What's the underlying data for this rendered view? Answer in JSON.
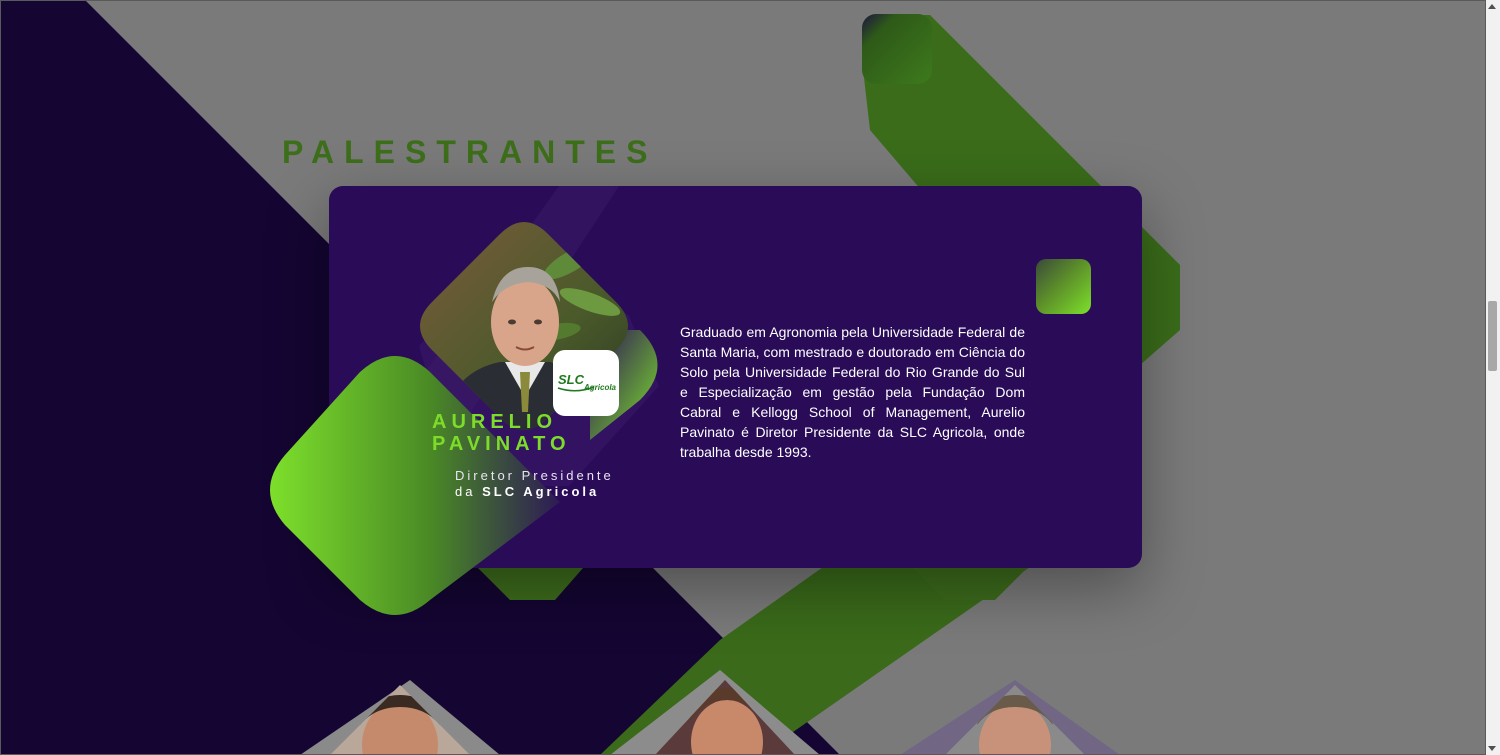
{
  "section": {
    "title": "PALESTRANTES"
  },
  "speaker": {
    "name_line1": "AURELIO",
    "name_line2": "PAVINATO",
    "role_line1": "Diretor Presidente",
    "role_prefix": "da ",
    "role_company": "SLC Agricola",
    "bio": "Graduado em Agronomia pela Universidade Federal de Santa Maria, com mestrado e doutorado em Ciência do Solo pela Universidade Federal do Rio Grande do Sul e Especialização em gestão pela Fundação Dom Cabral e Kellogg School of Management, Aurelio Pavinato é Diretor Presidente da SLC Agricola, onde trabalha desde 1993.",
    "logo_text_main": "SLC",
    "logo_text_sub": "Agricola"
  },
  "colors": {
    "brand_purple": "#290b58",
    "dark_purple": "#140532",
    "brand_green": "#7ddc2a",
    "title_green": "#3d6e1a",
    "overlay_gray": "#7a7a7a"
  },
  "icons": {
    "scroll_up": "chevron-up-icon",
    "scroll_down": "chevron-down-icon"
  }
}
